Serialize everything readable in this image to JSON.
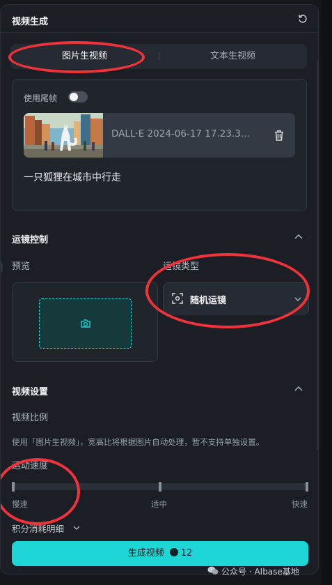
{
  "header": {
    "title": "视频生成",
    "refresh_icon": "refresh-icon"
  },
  "tabs": [
    {
      "label": "图片生视频",
      "active": true
    },
    {
      "label": "文本生视频",
      "active": false
    }
  ],
  "upload": {
    "toggle_label": "使用尾帧",
    "toggle_on": false,
    "file_name": "DALL·E 2024-06-17 17.23.3...",
    "prompt": "一只狐狸在城市中行走"
  },
  "camera_control": {
    "title": "运镜控制",
    "preview_label": "预览",
    "type_label": "运镜类型",
    "type_value": "随机运镜"
  },
  "video_settings": {
    "title": "视频设置",
    "ratio_label": "视频比例",
    "ratio_note": "使用「图片生视频」，宽高比将根据图片自动处理，暂不支持单独设置。",
    "speed_label": "运动速度",
    "speed_options": [
      "慢速",
      "适中",
      "快速"
    ],
    "speed_value": "慢速"
  },
  "cost": {
    "label": "积分消耗明细"
  },
  "generate": {
    "label": "生成视频",
    "credits": "12"
  },
  "watermark": {
    "text": "公众号 · AIbase基地"
  },
  "colors": {
    "accent": "#1ed6d6",
    "annotation": "#f0333a",
    "panel": "#1b1f25"
  }
}
